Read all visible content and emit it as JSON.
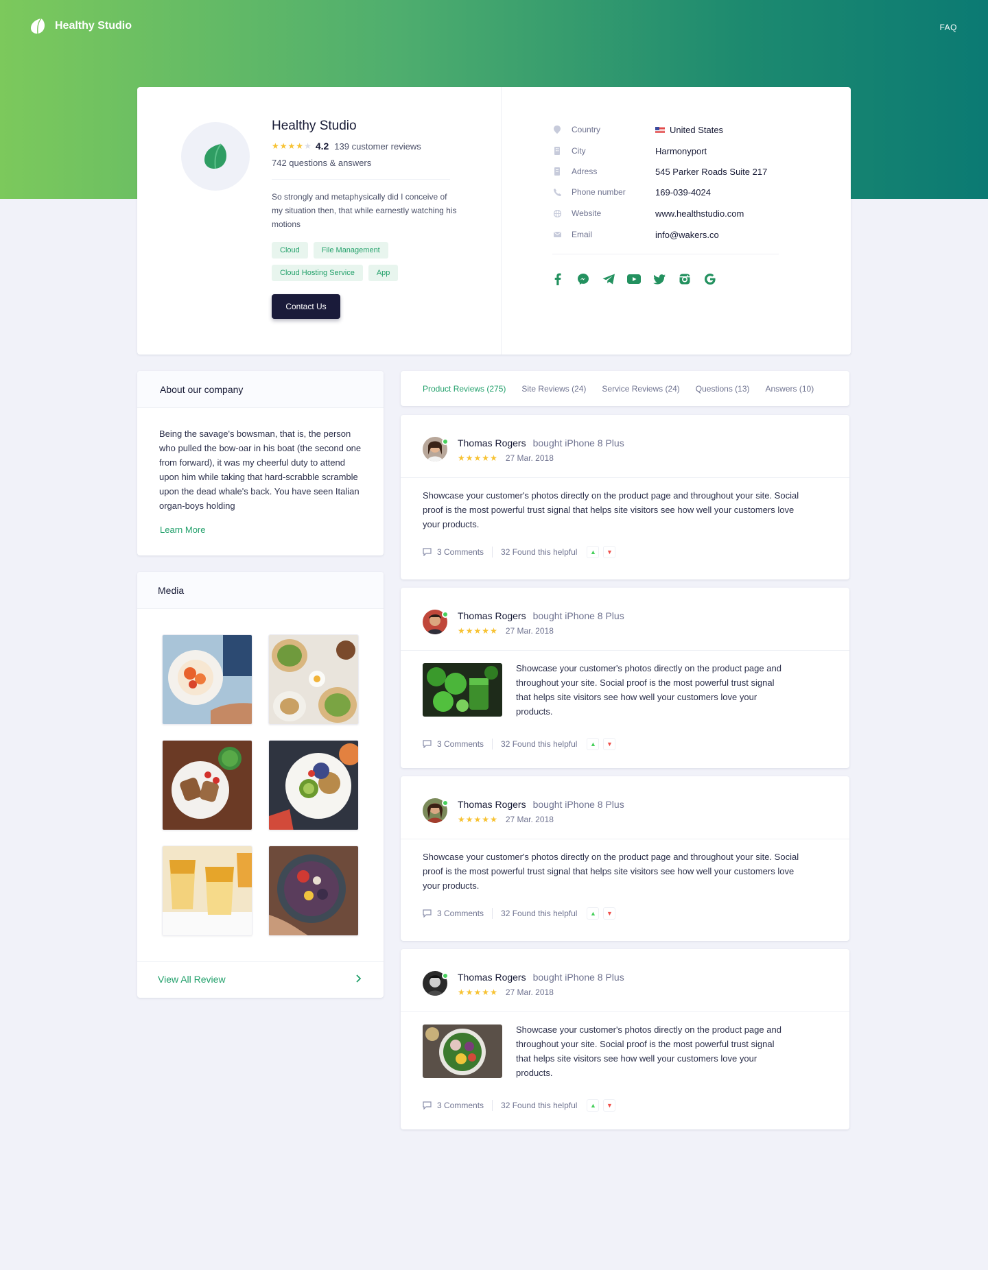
{
  "brand": {
    "name": "Healthy Studio"
  },
  "nav": {
    "faq": "FAQ"
  },
  "profile": {
    "name": "Healthy Studio",
    "rating": 4.2,
    "rating_text": "4.2",
    "reviews_count": "139 customer reviews",
    "qa_count": "742 questions & answers",
    "description": "So strongly and metaphysically did I conceive of my situation then, that while earnestly watching his motions",
    "tags": [
      "Cloud",
      "File Management",
      "Cloud Hosting Service",
      "App"
    ],
    "contact_label": "Contact Us"
  },
  "info": {
    "rows": [
      {
        "icon": "location-pin-icon",
        "label": "Country",
        "value": "United States",
        "flag": "us-flag-icon"
      },
      {
        "icon": "building-icon",
        "label": "City",
        "value": "Harmonyport"
      },
      {
        "icon": "address-icon",
        "label": "Adress",
        "value": "545 Parker Roads Suite 217"
      },
      {
        "icon": "phone-icon",
        "label": "Phone number",
        "value": "169-039-4024"
      },
      {
        "icon": "globe-icon",
        "label": "Website",
        "value": "www.healthstudio.com"
      },
      {
        "icon": "mail-icon",
        "label": "Email",
        "value": "info@wakers.co"
      }
    ],
    "socials": [
      "facebook-icon",
      "messenger-icon",
      "telegram-icon",
      "youtube-icon",
      "twitter-icon",
      "instagram-icon",
      "google-icon"
    ]
  },
  "about": {
    "title": "About our company",
    "text": "Being the savage's bowsman, that is, the person who pulled the bow-oar in his boat (the second one from forward), it was my cheerful duty to attend upon him while taking that hard-scrabble scramble upon the dead whale's back. You have seen Italian organ-boys holding",
    "link": "Learn More"
  },
  "media": {
    "title": "Media",
    "footer": "View All Review"
  },
  "tabs": [
    {
      "label": "Product Reviews (275)",
      "active": true
    },
    {
      "label": "Site Reviews (24)"
    },
    {
      "label": "Service Reviews (24)"
    },
    {
      "label": "Questions (13)"
    },
    {
      "label": "Answers (10)"
    }
  ],
  "reviews": [
    {
      "author": "Thomas Rogers",
      "product": "bought iPhone 8 Plus",
      "date": "27 Mar. 2018",
      "stars": 5,
      "text": "Showcase your customer's photos directly on the product page and throughout your site. Social proof is the most powerful trust signal that helps site visitors see how well your customers love your products.",
      "comments": "3 Comments",
      "helpful": "32 Found this helpful"
    },
    {
      "author": "Thomas Rogers",
      "product": "bought iPhone 8 Plus",
      "date": "27 Mar. 2018",
      "stars": 5,
      "text": "Showcase your customer's photos directly on the product page and throughout your site. Social proof is the most powerful trust signal that helps site visitors see how well your customers love your products.",
      "comments": "3 Comments",
      "helpful": "32 Found this helpful"
    },
    {
      "author": "Thomas Rogers",
      "product": "bought iPhone 8 Plus",
      "date": "27 Mar. 2018",
      "stars": 5,
      "text": "Showcase your customer's photos directly on the product page and throughout your site. Social proof is the most powerful trust signal that helps site visitors see how well your customers love your products.",
      "comments": "3 Comments",
      "helpful": "32 Found this helpful"
    },
    {
      "author": "Thomas Rogers",
      "product": "bought iPhone 8 Plus",
      "date": "27 Mar. 2018",
      "stars": 5,
      "text": "Showcase your customer's photos directly on the product page and throughout your site. Social proof is the most powerful trust signal that helps site visitors see how well your customers love your products.",
      "comments": "3 Comments",
      "helpful": "32 Found this helpful"
    }
  ],
  "colors": {
    "accent_green": "#22a06b",
    "dark_button": "#1a1b3a",
    "star": "#f7c232",
    "online": "#47d05c",
    "page_bg": "#f1f2f9"
  }
}
